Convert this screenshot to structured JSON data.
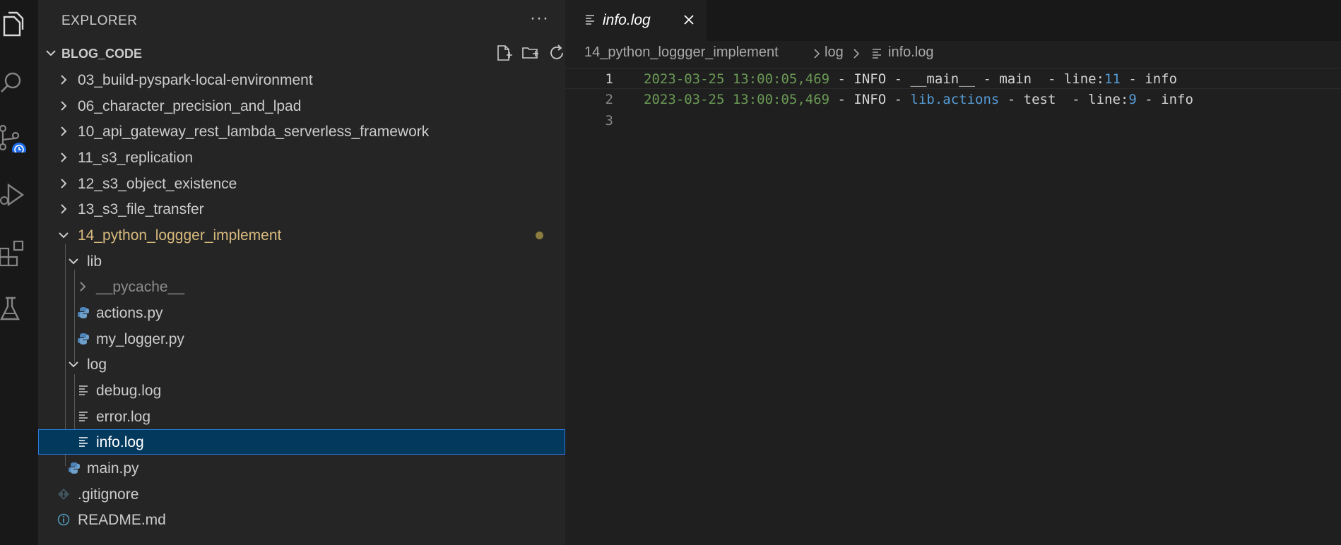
{
  "explorer": {
    "title": "EXPLORER",
    "more_label": "···",
    "workspace": "BLOG_CODE",
    "tree": [
      {
        "label": "03_build-pyspark-local-environment",
        "kind": "folder",
        "expanded": false,
        "state": "normal"
      },
      {
        "label": "06_character_precision_and_lpad",
        "kind": "folder",
        "expanded": false,
        "state": "normal"
      },
      {
        "label": "10_api_gateway_rest_lambda_serverless_framework",
        "kind": "folder",
        "expanded": false,
        "state": "normal"
      },
      {
        "label": "11_s3_replication",
        "kind": "folder",
        "expanded": false,
        "state": "normal"
      },
      {
        "label": "12_s3_object_existence",
        "kind": "folder",
        "expanded": false,
        "state": "normal"
      },
      {
        "label": "13_s3_file_transfer",
        "kind": "folder",
        "expanded": false,
        "state": "normal"
      },
      {
        "label": "14_python_loggger_implement",
        "kind": "folder",
        "expanded": true,
        "state": "modified"
      },
      {
        "label": "lib",
        "kind": "folder",
        "expanded": true,
        "state": "normal"
      },
      {
        "label": "__pycache__",
        "kind": "folder",
        "expanded": false,
        "state": "ignored"
      },
      {
        "label": "actions.py",
        "kind": "python",
        "state": "normal"
      },
      {
        "label": "my_logger.py",
        "kind": "python",
        "state": "normal"
      },
      {
        "label": "log",
        "kind": "folder",
        "expanded": true,
        "state": "normal"
      },
      {
        "label": "debug.log",
        "kind": "log",
        "state": "normal"
      },
      {
        "label": "error.log",
        "kind": "log",
        "state": "normal"
      },
      {
        "label": "info.log",
        "kind": "log",
        "state": "selected"
      },
      {
        "label": "main.py",
        "kind": "python",
        "state": "normal"
      },
      {
        "label": ".gitignore",
        "kind": "git",
        "state": "normal"
      },
      {
        "label": "README.md",
        "kind": "info",
        "state": "normal"
      }
    ]
  },
  "editor": {
    "tab": {
      "label": "info.log"
    },
    "breadcrumb": [
      "14_python_loggger_implement",
      "log",
      "info.log"
    ],
    "lines": [
      {
        "number": "1",
        "date": "2023-03-25 13:00:05,469",
        "sep1": " - INFO - ",
        "module": "__main__",
        "sep2": " - main  - line:",
        "lineno": "11",
        "sep3": " - info"
      },
      {
        "number": "2",
        "date": "2023-03-25 13:00:05,469",
        "sep1": " - INFO - ",
        "module": "lib.actions",
        "sep2": " - test  - line:",
        "lineno": "9",
        "sep3": " - info"
      },
      {
        "number": "3"
      }
    ]
  },
  "colors": {
    "accent": "#2b79d8",
    "selection": "#04395e",
    "modified": "#d7ba7d",
    "badge": "#1f6feb"
  }
}
